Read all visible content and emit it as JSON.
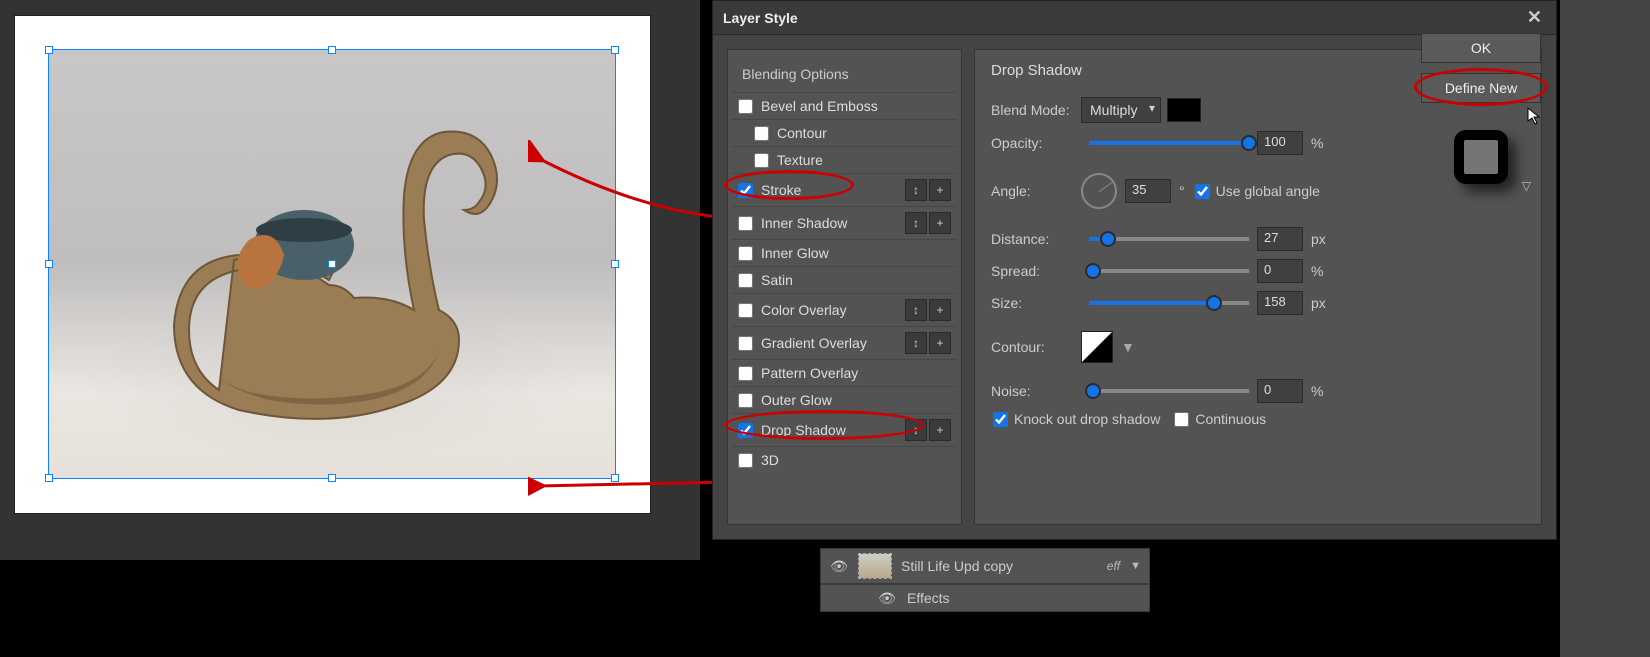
{
  "dialog": {
    "title": "Layer Style",
    "ok": "OK",
    "define_new": "Define New"
  },
  "styles": {
    "header": "Blending Options",
    "bevel": "Bevel and Emboss",
    "contour": "Contour",
    "texture": "Texture",
    "stroke": "Stroke",
    "inner_shadow": "Inner Shadow",
    "inner_glow": "Inner Glow",
    "satin": "Satin",
    "color_overlay": "Color Overlay",
    "gradient_overlay": "Gradient Overlay",
    "pattern_overlay": "Pattern Overlay",
    "outer_glow": "Outer Glow",
    "drop_shadow": "Drop Shadow",
    "three_d": "3D",
    "checked": {
      "bevel": false,
      "contour": false,
      "texture": false,
      "stroke": true,
      "inner_shadow": false,
      "inner_glow": false,
      "satin": false,
      "color_overlay": false,
      "gradient_overlay": false,
      "pattern_overlay": false,
      "outer_glow": false,
      "drop_shadow": true,
      "three_d": false
    }
  },
  "panel": {
    "title": "Drop Shadow",
    "blend_mode_label": "Blend Mode:",
    "blend_mode_value": "Multiply",
    "opacity_label": "Opacity:",
    "opacity_value": "100",
    "opacity_unit": "%",
    "angle_label": "Angle:",
    "angle_value": "35",
    "angle_unit": "°",
    "use_global_angle": "Use global angle",
    "distance_label": "Distance:",
    "distance_value": "27",
    "distance_unit": "px",
    "spread_label": "Spread:",
    "spread_value": "0",
    "spread_unit": "%",
    "size_label": "Size:",
    "size_value": "158",
    "size_unit": "px",
    "contour_label": "Contour:",
    "noise_label": "Noise:",
    "noise_value": "0",
    "noise_unit": "%",
    "knock_out": "Knock out drop shadow",
    "continuous": "Continuous"
  },
  "layers": {
    "name": "Still Life Upd copy",
    "eff": "eff",
    "effects": "Effects"
  }
}
